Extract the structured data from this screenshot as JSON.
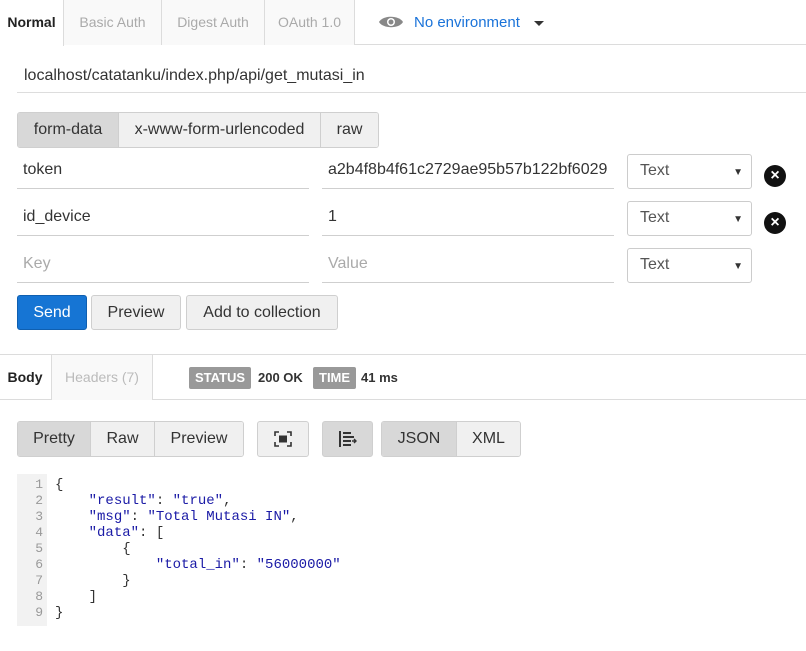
{
  "auth_tabs": [
    "Normal",
    "Basic Auth",
    "Digest Auth",
    "OAuth 1.0"
  ],
  "environment": {
    "label": "No environment",
    "icon": "eye-icon"
  },
  "url": "localhost/catatanku/index.php/api/get_mutasi_in",
  "body_types": [
    "form-data",
    "x-www-form-urlencoded",
    "raw"
  ],
  "params": [
    {
      "key": "token",
      "value": "a2b4f8b4f61c2729ae95b57b122bf6029",
      "type": "Text"
    },
    {
      "key": "id_device",
      "value": "1",
      "type": "Text"
    }
  ],
  "new_param": {
    "key_placeholder": "Key",
    "value_placeholder": "Value",
    "type": "Text"
  },
  "actions": {
    "send": "Send",
    "preview": "Preview",
    "add": "Add to collection"
  },
  "response": {
    "tabs": [
      "Body",
      "Headers (7)"
    ],
    "status_label": "STATUS",
    "status_value": "200 OK",
    "time_label": "TIME",
    "time_value": "41 ms"
  },
  "view_modes": [
    "Pretty",
    "Raw",
    "Preview"
  ],
  "format_modes": [
    "JSON",
    "XML"
  ],
  "icons": {
    "fullscreen": "fullscreen-icon",
    "wrap": "wrap-lines-icon",
    "remove": "remove-icon"
  },
  "code_lines": [
    {
      "n": "1",
      "t": "{"
    },
    {
      "n": "2",
      "t": "    \"result\": \"true\","
    },
    {
      "n": "3",
      "t": "    \"msg\": \"Total Mutasi IN\","
    },
    {
      "n": "4",
      "t": "    \"data\": ["
    },
    {
      "n": "5",
      "t": "        {"
    },
    {
      "n": "6",
      "t": "            \"total_in\": \"56000000\""
    },
    {
      "n": "7",
      "t": "        }"
    },
    {
      "n": "8",
      "t": "    ]"
    },
    {
      "n": "9",
      "t": "}"
    }
  ],
  "colors": {
    "primary": "#1675d4",
    "link": "#1a73d9",
    "json_string": "#1a1aa6"
  }
}
